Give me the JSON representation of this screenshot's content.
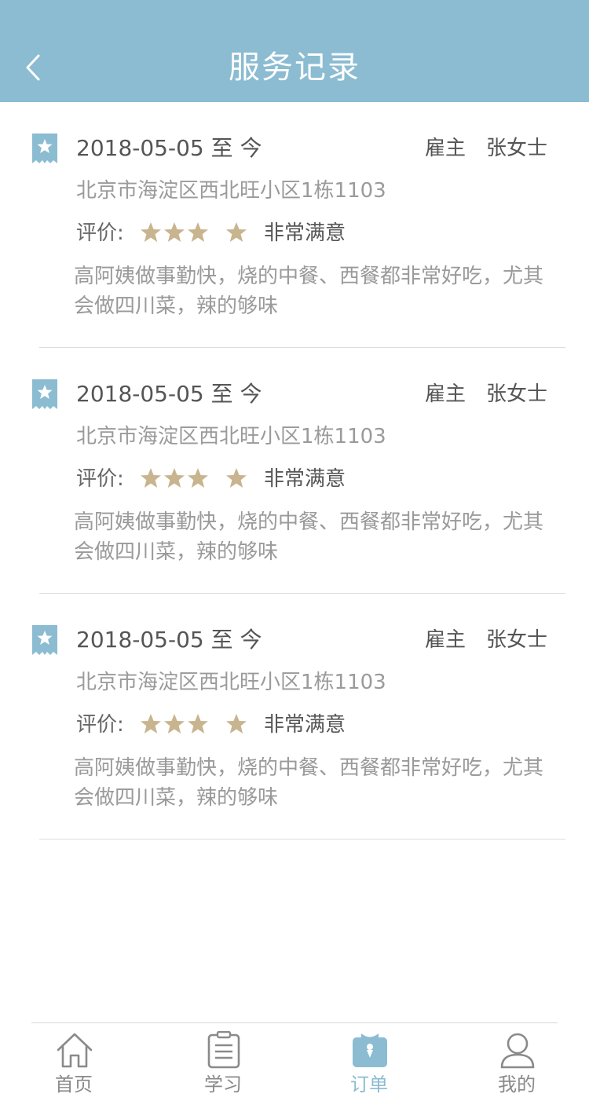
{
  "header": {
    "title": "服务记录",
    "back_icon": "chevron-left-icon"
  },
  "colors": {
    "header_bg": "#8bbcd1",
    "star": "#c8b48e",
    "active_tab": "#8bbcd1"
  },
  "records": [
    {
      "date": "2018-05-05 至 今",
      "role": "雇主",
      "person": "张女士",
      "address": "北京市海淀区西北旺小区1栋1103",
      "rating_label": "评价:",
      "stars": 4,
      "rating_text": "非常满意",
      "comment": "高阿姨做事勤快，烧的中餐、西餐都非常好吃，尤其会做四川菜，辣的够味"
    },
    {
      "date": "2018-05-05 至 今",
      "role": "雇主",
      "person": "张女士",
      "address": "北京市海淀区西北旺小区1栋1103",
      "rating_label": "评价:",
      "stars": 4,
      "rating_text": "非常满意",
      "comment": "高阿姨做事勤快，烧的中餐、西餐都非常好吃，尤其会做四川菜，辣的够味"
    },
    {
      "date": "2018-05-05 至 今",
      "role": "雇主",
      "person": "张女士",
      "address": "北京市海淀区西北旺小区1栋1103",
      "rating_label": "评价:",
      "stars": 4,
      "rating_text": "非常满意",
      "comment": "高阿姨做事勤快，烧的中餐、西餐都非常好吃，尤其会做四川菜，辣的够味"
    }
  ],
  "nav": {
    "items": [
      {
        "label": "首页",
        "icon": "home-icon",
        "active": false
      },
      {
        "label": "学习",
        "icon": "clipboard-icon",
        "active": false
      },
      {
        "label": "订单",
        "icon": "order-bag-icon",
        "active": true
      },
      {
        "label": "我的",
        "icon": "user-icon",
        "active": false
      }
    ]
  }
}
